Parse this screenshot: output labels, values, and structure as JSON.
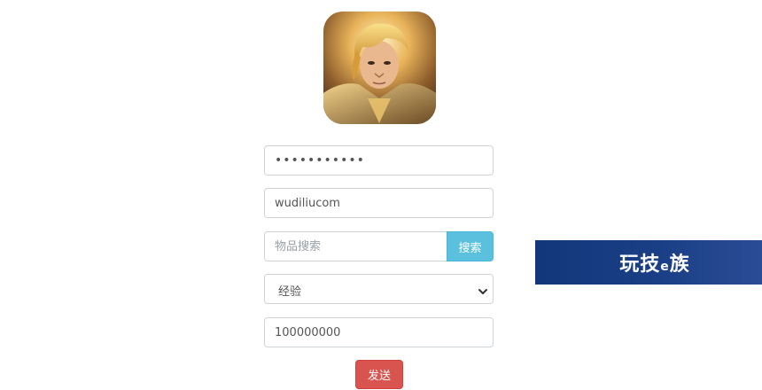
{
  "avatar": {
    "icon": "game-hero-avatar"
  },
  "form": {
    "password_value": "•••••••••••",
    "username_value": "wudiliucom",
    "search_placeholder": "物品搜索",
    "search_button_label": "搜索",
    "type_select_value": "经验",
    "amount_value": "100000000",
    "send_button_label": "发送"
  },
  "colors": {
    "search_button": "#5bc0de",
    "send_button": "#d9534f",
    "watermark_bg": "#1b3f86"
  },
  "watermark": {
    "text_a": "玩技",
    "text_e": "e",
    "text_b": "族"
  }
}
